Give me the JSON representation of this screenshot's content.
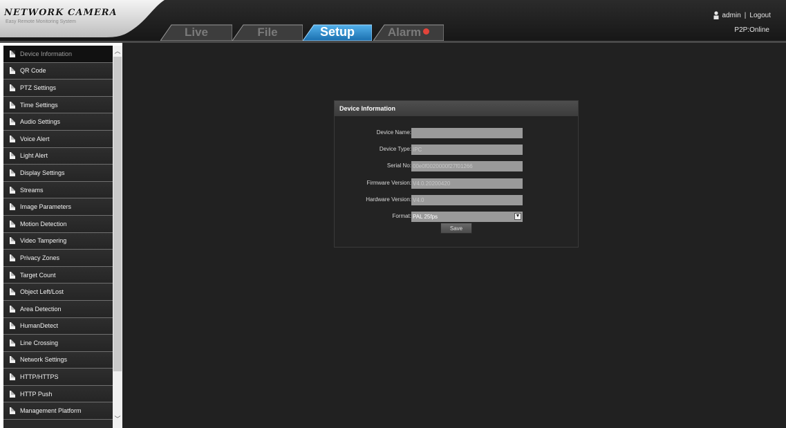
{
  "header": {
    "logo_text": "NETWORK CAMERA",
    "logo_subtitle": "Easy Remote Monitoring System",
    "user": "admin",
    "separator": "|",
    "logout": "Logout",
    "p2p_status": "P2P:Online",
    "tabs": [
      {
        "label": "Live",
        "active": false
      },
      {
        "label": "File",
        "active": false
      },
      {
        "label": "Setup",
        "active": true
      },
      {
        "label": "Alarm",
        "active": false,
        "icon": "alarm-dot-icon"
      }
    ]
  },
  "sidebar": {
    "items": [
      {
        "label": "Device Information",
        "active": true
      },
      {
        "label": "QR Code"
      },
      {
        "label": "PTZ Settings"
      },
      {
        "label": "Time Settings"
      },
      {
        "label": "Audio Settings"
      },
      {
        "label": "Voice Alert"
      },
      {
        "label": "Light Alert"
      },
      {
        "label": "Display Settings"
      },
      {
        "label": "Streams"
      },
      {
        "label": "Image Parameters"
      },
      {
        "label": "Motion Detection"
      },
      {
        "label": "Video Tampering"
      },
      {
        "label": "Privacy Zones"
      },
      {
        "label": "Target Count"
      },
      {
        "label": "Object Left/Lost"
      },
      {
        "label": "Area Detection"
      },
      {
        "label": "HumanDetect"
      },
      {
        "label": "Line Crossing"
      },
      {
        "label": "Network Settings"
      },
      {
        "label": "HTTP/HTTPS"
      },
      {
        "label": "HTTP Push"
      },
      {
        "label": "Management Platform"
      }
    ]
  },
  "panel": {
    "title": "Device Information",
    "fields": [
      {
        "label": "Device Name:",
        "value": ""
      },
      {
        "label": "Device Type:",
        "value": "IPC"
      },
      {
        "label": "Serial No:",
        "value": "00e0f0020000f27f01266"
      },
      {
        "label": "Firmware Version:",
        "value": "V4.0.20200420"
      },
      {
        "label": "Hardware Version:",
        "value": "V4.0"
      }
    ],
    "format": {
      "label": "Format:",
      "value": "PAL 25fps"
    },
    "save_label": "Save"
  },
  "colors": {
    "header_bg": "#1e1e1e",
    "main_bg": "#212121",
    "sidebar_bg": "#2b2b2b",
    "tab_active": "#1f7fc4",
    "alarm_dot": "#e2443a",
    "input_bg": "#9a9a9a"
  }
}
